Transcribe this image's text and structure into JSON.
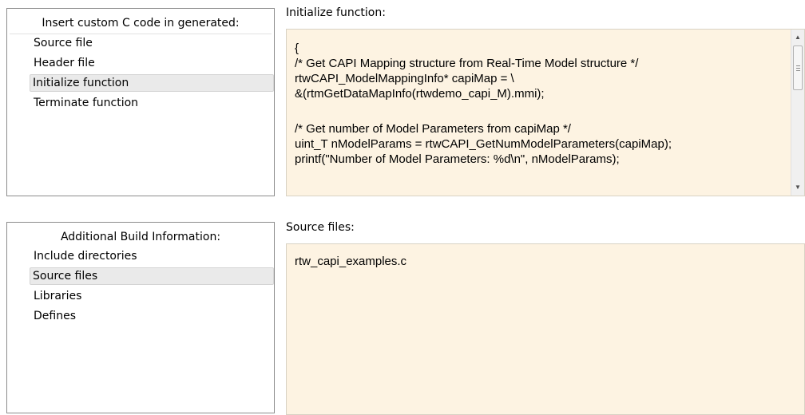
{
  "custom_code": {
    "panel_title": "Insert custom C code in generated:",
    "items": [
      {
        "label": "Source file"
      },
      {
        "label": "Header file"
      },
      {
        "label": "Initialize function"
      },
      {
        "label": "Terminate function"
      }
    ],
    "selected_item": "Initialize function",
    "editor_label": "Initialize function:",
    "editor_lines": [
      "{",
      "/* Get CAPI Mapping structure from Real-Time Model structure */",
      "rtwCAPI_ModelMappingInfo* capiMap = \\",
      "&(rtmGetDataMapInfo(rtwdemo_capi_M).mmi);",
      "",
      "/* Get number of Model Parameters from capiMap */",
      "uint_T nModelParams = rtwCAPI_GetNumModelParameters(capiMap);",
      "printf(\"Number of Model Parameters: %d\\n\", nModelParams);"
    ]
  },
  "build_info": {
    "panel_title": "Additional Build Information:",
    "items": [
      {
        "label": "Include directories"
      },
      {
        "label": "Source files"
      },
      {
        "label": "Libraries"
      },
      {
        "label": "Defines"
      }
    ],
    "selected_item": "Source files",
    "editor_label": "Source files:",
    "editor_lines": [
      "rtw_capi_examples.c"
    ]
  },
  "colors": {
    "editor_background": "#fdf3e2",
    "selection_background": "#eaeaea",
    "panel_border": "#8c8c8c"
  },
  "icons": {
    "scroll_up": "scroll-up-arrow-icon",
    "scroll_down": "scroll-down-arrow-icon",
    "scroll_grip": "scroll-thumb-grip-icon"
  }
}
